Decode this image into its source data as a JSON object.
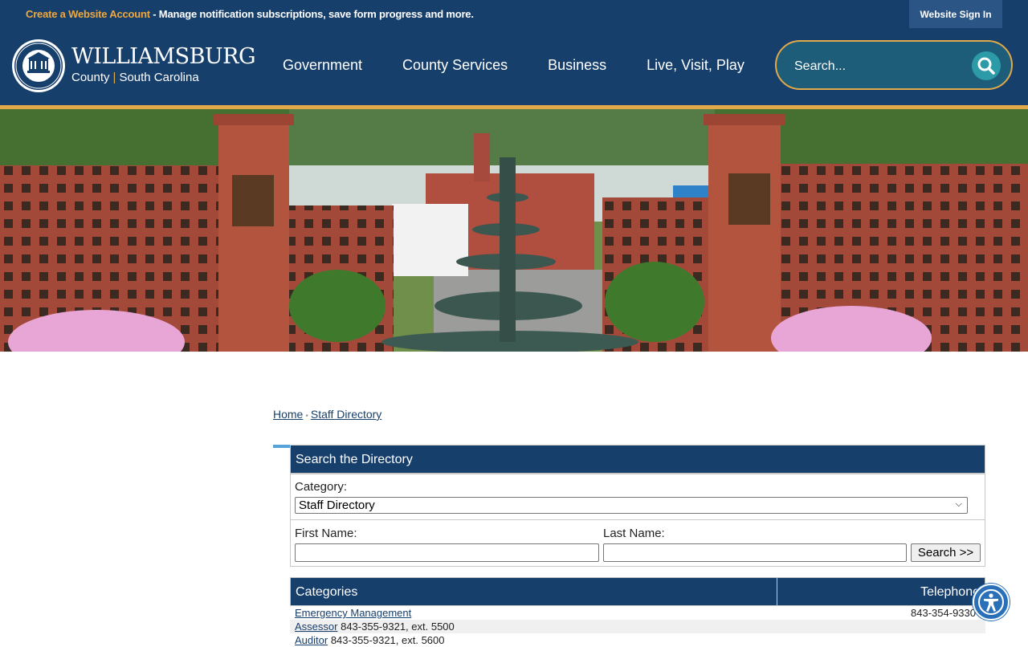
{
  "topbar": {
    "link": "Create a Website Account",
    "message": " - Manage notification subscriptions, save form progress and more.",
    "signin": "Website Sign In"
  },
  "brand": {
    "name": "WILLIAMSBURG",
    "county": "County",
    "state": "South Carolina"
  },
  "nav": [
    "Government",
    "County Services",
    "Business",
    "Live, Visit, Play"
  ],
  "search": {
    "placeholder": "Search..."
  },
  "breadcrumb": {
    "home": "Home",
    "current": "Staff Directory"
  },
  "directory": {
    "title": "Search the Directory",
    "category_label": "Category:",
    "category_value": "Staff Directory",
    "first_name_label": "First Name:",
    "last_name_label": "Last Name:",
    "search_button": "Search >>"
  },
  "results": {
    "col_categories": "Categories",
    "col_telephone": "Telephone",
    "rows": [
      {
        "name": "Emergency Management",
        "phone": "843-354-9330",
        "inline_phone": ""
      },
      {
        "name": "Assessor",
        "phone": "",
        "inline_phone": "843-355-9321, ext. 5500"
      },
      {
        "name": "Auditor",
        "phone": "",
        "inline_phone": "843-355-9321, ext. 5600"
      }
    ]
  },
  "colors": {
    "navy": "#173f6c",
    "gold": "#e2a94a",
    "teal": "#2d9aa8"
  }
}
